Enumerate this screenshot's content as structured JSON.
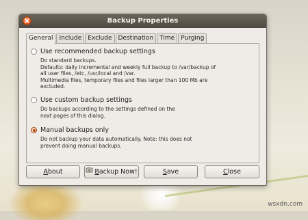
{
  "window": {
    "title": "Backup Properties"
  },
  "tabs": [
    {
      "label": "General",
      "active": true
    },
    {
      "label": "Include",
      "active": false
    },
    {
      "label": "Exclude",
      "active": false
    },
    {
      "label": "Destination",
      "active": false
    },
    {
      "label": "Time",
      "active": false
    },
    {
      "label": "Purging",
      "active": false
    }
  ],
  "options": {
    "recommended": {
      "label": "Use recommended backup settings",
      "checked": false,
      "desc": [
        "Do standard backups.",
        "Defaults: daily incremental and weekly full backup to /var/backup of",
        "all user files, /etc, /usr/local and /var.",
        "Multimedia files, temporary files and files larger than 100 Mb are",
        "excluded."
      ]
    },
    "custom": {
      "label": "Use custom backup settings",
      "checked": false,
      "desc": [
        "Do backups according to the settings defined on the",
        "next pages of this dialog."
      ]
    },
    "manual": {
      "label": "Manual backups only",
      "checked": true,
      "desc": [
        "Do not backup your data automatically. Note: this does not",
        "prevent doing manual backups."
      ]
    }
  },
  "buttons": {
    "about": {
      "mnemonic": "A",
      "rest": "bout"
    },
    "backup_now": {
      "mnemonic": "B",
      "rest": "ackup Now!"
    },
    "save": {
      "mnemonic": "S",
      "rest": "ave"
    },
    "close": {
      "mnemonic": "C",
      "rest": "lose"
    }
  },
  "watermark": "wsxdn.com",
  "colors": {
    "titlebar": "#4f4a42",
    "radio_accent": "#b5490f",
    "window_bg": "#efebe7"
  }
}
